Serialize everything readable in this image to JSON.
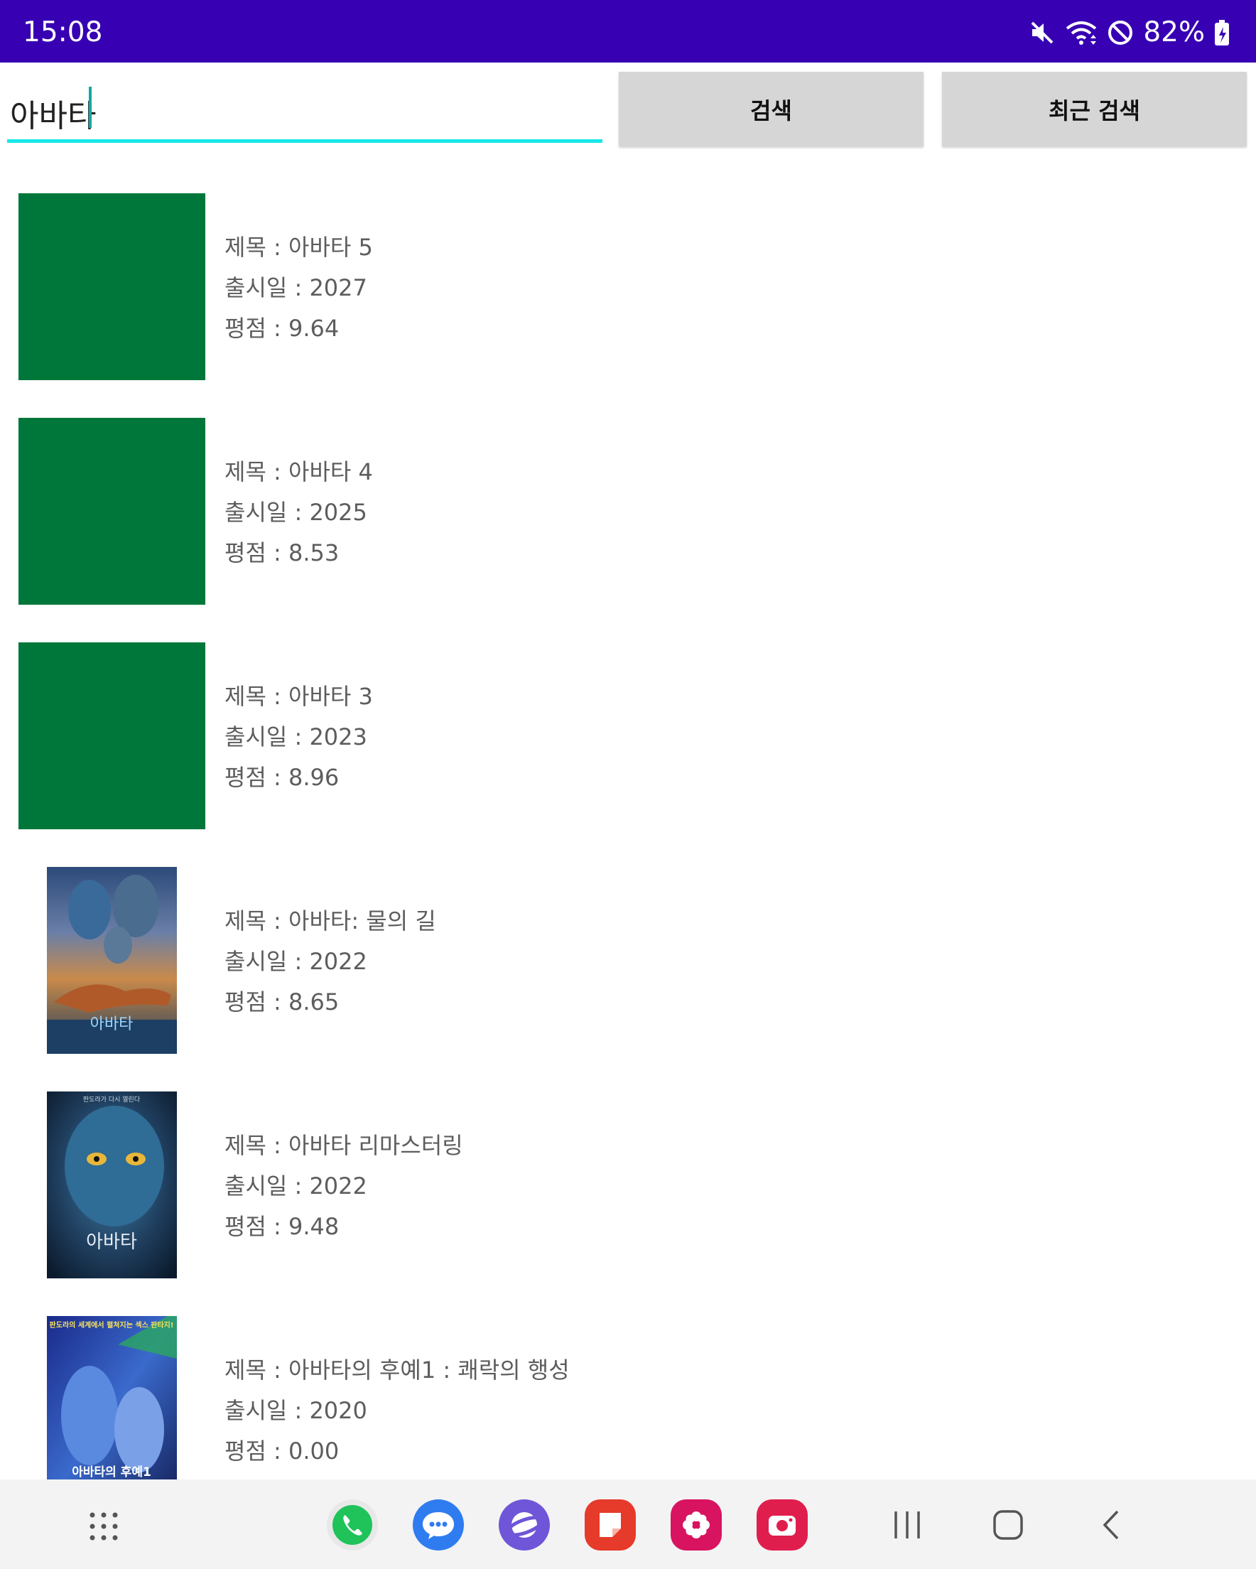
{
  "status_bar": {
    "time": "15:08",
    "battery_percent": "82%",
    "icons": [
      "mute-icon",
      "wifi-icon",
      "do-not-disturb-icon",
      "battery-charging-icon"
    ]
  },
  "search": {
    "value": "아바타",
    "search_button": "검색",
    "recent_button": "최근 검색",
    "underline_color": "#18e8e8"
  },
  "results": [
    {
      "title": "제목 : 아바타 5",
      "release": "출시일 : 2027",
      "rating": "평점 : 9.64",
      "thumb": "placeholder-green"
    },
    {
      "title": "제목 : 아바타 4",
      "release": "출시일 : 2025",
      "rating": "평점 : 8.53",
      "thumb": "placeholder-green"
    },
    {
      "title": "제목 : 아바타 3",
      "release": "출시일 : 2023",
      "rating": "평점 : 8.96",
      "thumb": "placeholder-green"
    },
    {
      "title": "제목 : 아바타: 물의 길",
      "release": "출시일 : 2022",
      "rating": "평점 : 8.65",
      "thumb": "poster",
      "poster_text": "아바타"
    },
    {
      "title": "제목 : 아바타 리마스터링",
      "release": "출시일 : 2022",
      "rating": "평점 : 9.48",
      "thumb": "poster",
      "poster_text": "아바타",
      "poster_top_text": "판도라가 다시 열린다"
    },
    {
      "title": "제목 : 아바타의 후예1 : 쾌락의 행성",
      "release": "출시일 : 2020",
      "rating": "평점 : 0.00",
      "thumb": "poster",
      "poster_text": "아바타의 후예1",
      "poster_top_text": "판도라의 세계에서 펼쳐지는 섹스 판타지!"
    }
  ],
  "nav_bar": {
    "apps": [
      "apps-grid-icon",
      "phone-icon",
      "messages-icon",
      "internet-icon",
      "notes-icon",
      "gallery-icon",
      "camera-icon"
    ],
    "buttons": [
      "recents-icon",
      "home-icon",
      "back-icon"
    ]
  },
  "colors": {
    "status_bar": "#3700b3",
    "placeholder_thumb": "#00773a",
    "button_bg": "#d6d6d6"
  }
}
